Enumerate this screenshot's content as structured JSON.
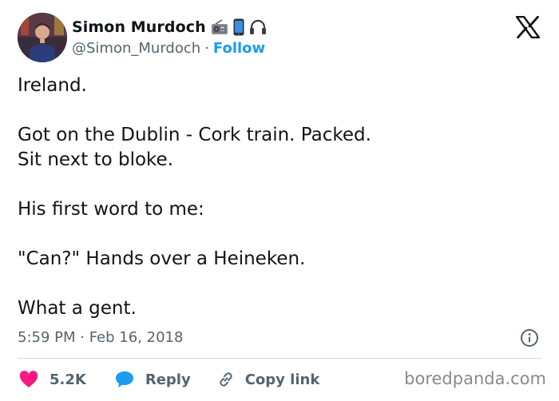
{
  "author": {
    "display_name": "Simon Murdoch",
    "handle": "@Simon_Murdoch",
    "separator": "·",
    "follow_label": "Follow",
    "name_emojis": [
      "radio-icon",
      "mobile-phone-icon",
      "headphones-icon"
    ]
  },
  "tweet": {
    "lines": [
      "Ireland.",
      "",
      "Got on the Dublin - Cork train. Packed.",
      "Sit next to bloke.",
      "",
      "His first word to me:",
      "",
      "\"Can?\" Hands over a Heineken.",
      "",
      "What a gent."
    ],
    "timestamp": "5:59 PM · Feb 16, 2018"
  },
  "actions": {
    "like_count": "5.2K",
    "reply_label": "Reply",
    "copy_link_label": "Copy link"
  },
  "watermark": "boredpanda.com",
  "colors": {
    "text": "#0f1419",
    "secondary": "#536471",
    "accent": "#1d9bf0",
    "like": "#f91880",
    "reply_bubble": "#1d9bf0",
    "divider": "#cfd9de"
  }
}
